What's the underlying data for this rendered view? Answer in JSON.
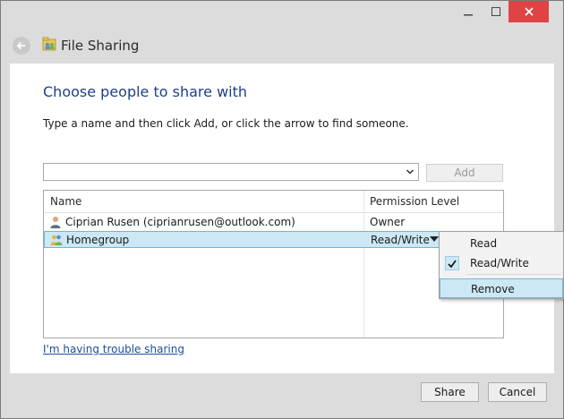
{
  "window": {
    "title": "File Sharing"
  },
  "content": {
    "heading": "Choose people to share with",
    "instruction": "Type a name and then click Add, or click the arrow to find someone.",
    "name_input": {
      "value": "",
      "placeholder": ""
    },
    "add_label": "Add"
  },
  "table": {
    "columns": [
      "Name",
      "Permission Level"
    ],
    "rows": [
      {
        "name": "Ciprian Rusen (ciprianrusen@outlook.com)",
        "permission": "Owner",
        "icon": "user-icon"
      },
      {
        "name": "Homegroup",
        "permission": "Read/Write",
        "icon": "homegroup-icon"
      }
    ]
  },
  "permission_menu": {
    "items": [
      {
        "label": "Read",
        "checked": false
      },
      {
        "label": "Read/Write",
        "checked": true
      },
      {
        "label": "Remove",
        "checked": false
      }
    ]
  },
  "trouble_link": "I'm having trouble sharing",
  "footer": {
    "share_label": "Share",
    "cancel_label": "Cancel"
  },
  "colors": {
    "heading": "#1e3f8a",
    "selection": "#cce8f4",
    "close_button": "#e04343",
    "link": "#1a4fa3"
  }
}
